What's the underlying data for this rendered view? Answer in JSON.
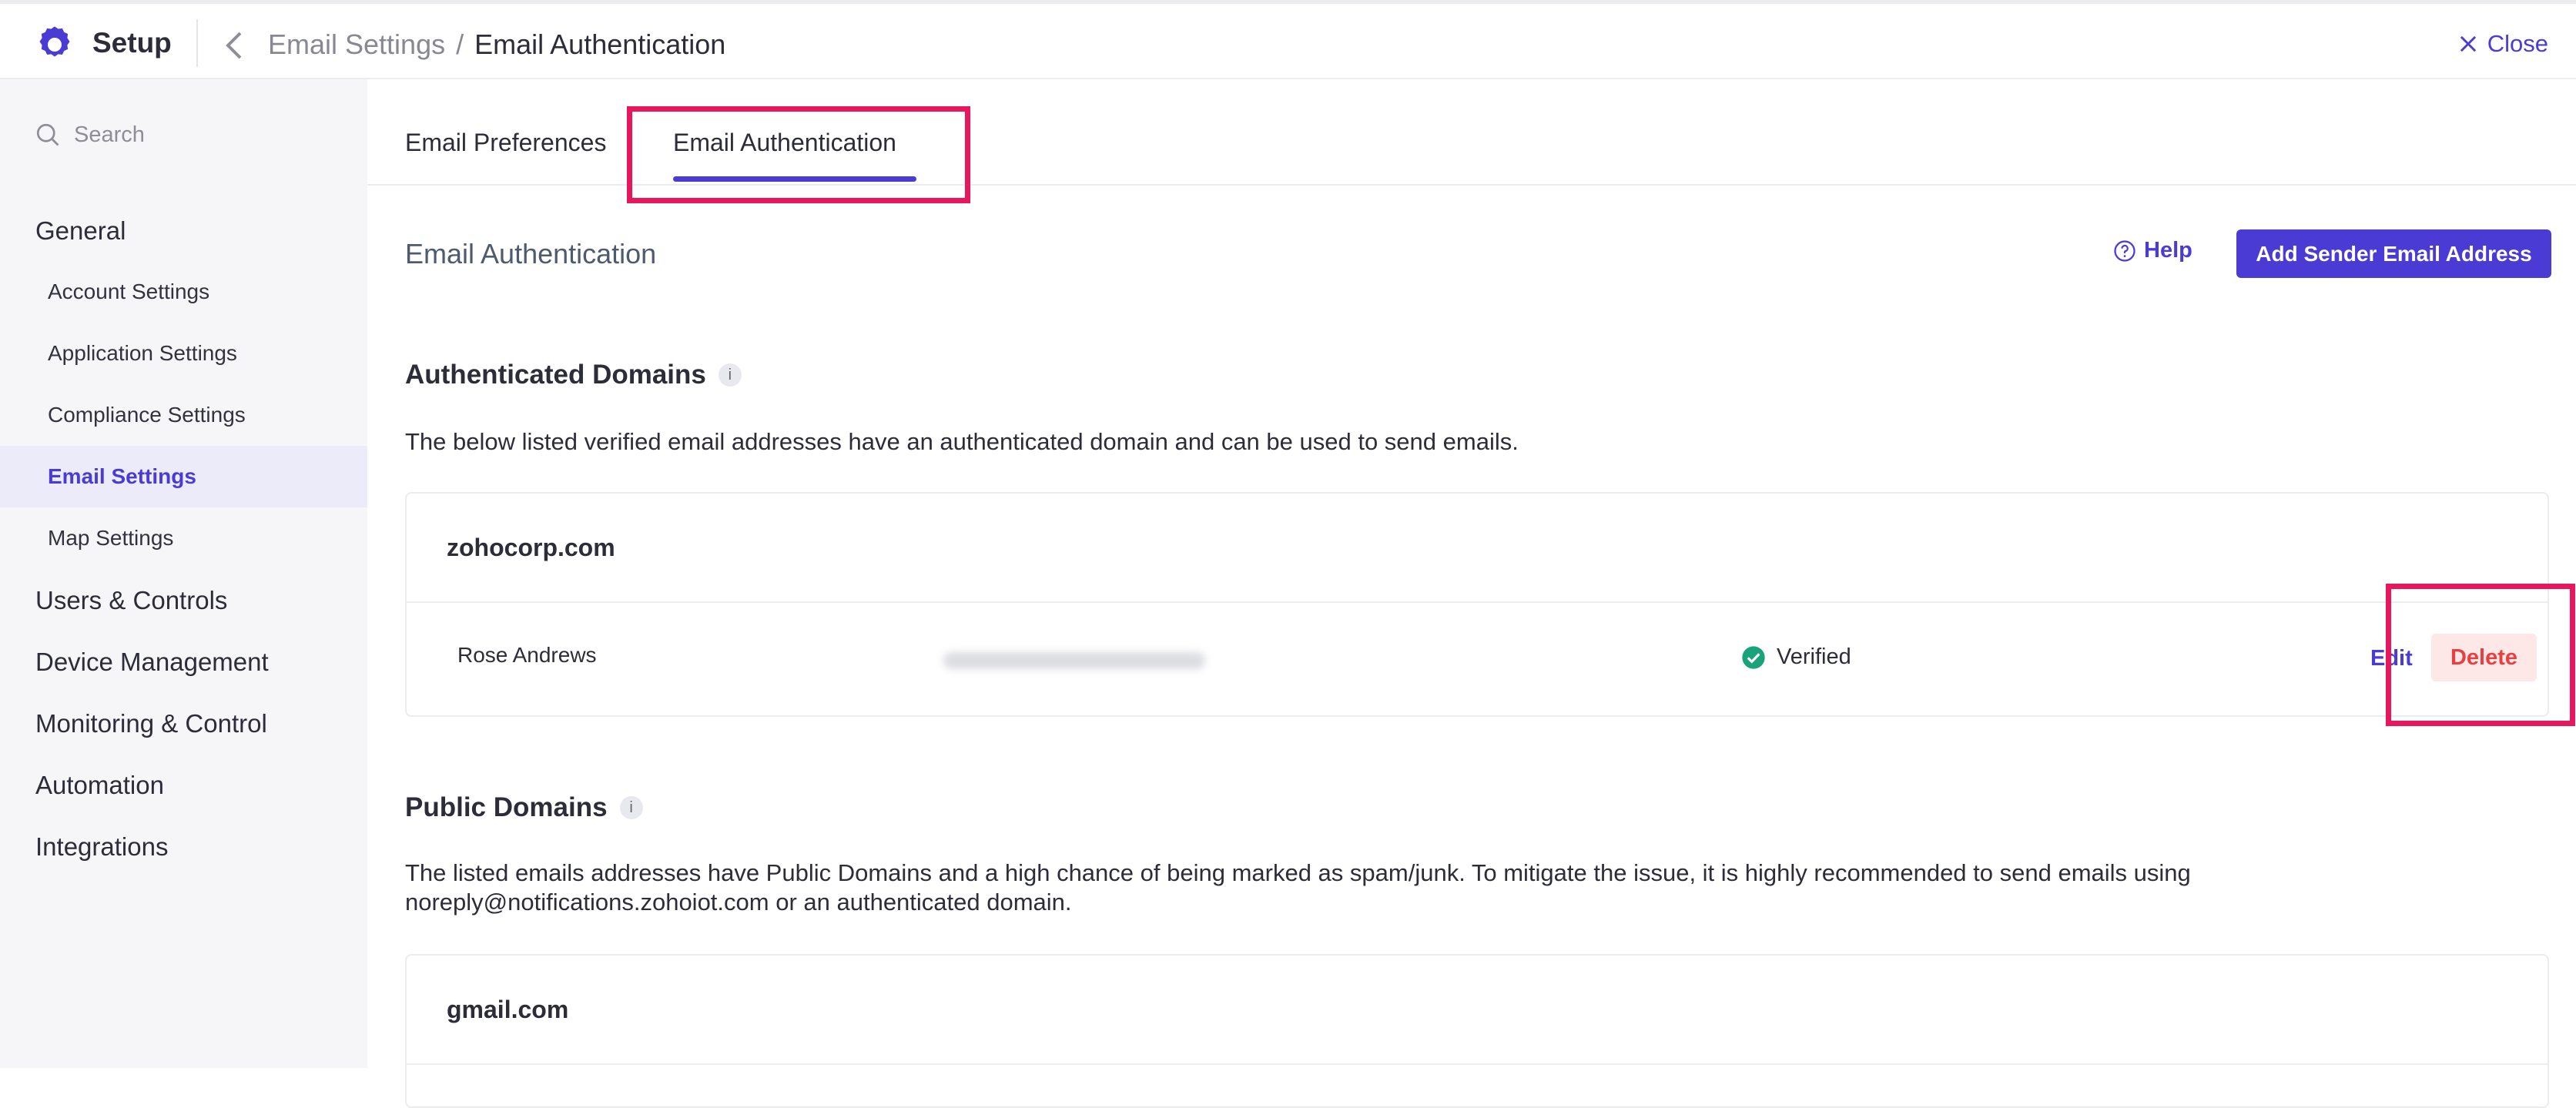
{
  "header": {
    "app_title": "Setup",
    "breadcrumb_parent": "Email Settings",
    "breadcrumb_separator": "/",
    "breadcrumb_current": "Email Authentication",
    "close_label": "Close"
  },
  "sidebar": {
    "search_placeholder": "Search",
    "general": "General",
    "items": [
      {
        "label": "Account Settings"
      },
      {
        "label": "Application Settings"
      },
      {
        "label": "Compliance Settings"
      },
      {
        "label": "Email Settings"
      },
      {
        "label": "Map Settings"
      }
    ],
    "groups": [
      {
        "label": "Users & Controls"
      },
      {
        "label": "Device Management"
      },
      {
        "label": "Monitoring & Control"
      },
      {
        "label": "Automation"
      },
      {
        "label": "Integrations"
      }
    ]
  },
  "tabs": [
    {
      "label": "Email Preferences"
    },
    {
      "label": "Email Authentication"
    }
  ],
  "main": {
    "section_title": "Email Authentication",
    "help_label": "Help",
    "add_button": "Add Sender Email Address",
    "authenticated": {
      "title": "Authenticated Domains",
      "description": "The below listed verified email addresses have an authenticated domain and can be used to send emails.",
      "domain": "zohocorp.com",
      "row": {
        "name": "Rose Andrews",
        "status": "Verified",
        "edit": "Edit",
        "delete": "Delete"
      }
    },
    "public": {
      "title": "Public Domains",
      "description_line1": "The listed emails addresses have Public Domains and a high chance of being marked as spam/junk. To mitigate the issue, it is highly recommended to send emails using",
      "description_line2": "noreply@notifications.zohoiot.com or an authenticated domain.",
      "domain": "gmail.com"
    }
  },
  "colors": {
    "accent": "#4a3bd4",
    "highlight": "#e8175d",
    "verified": "#1aa37a",
    "delete_bg": "#fde7e7",
    "delete_text": "#e84040"
  }
}
